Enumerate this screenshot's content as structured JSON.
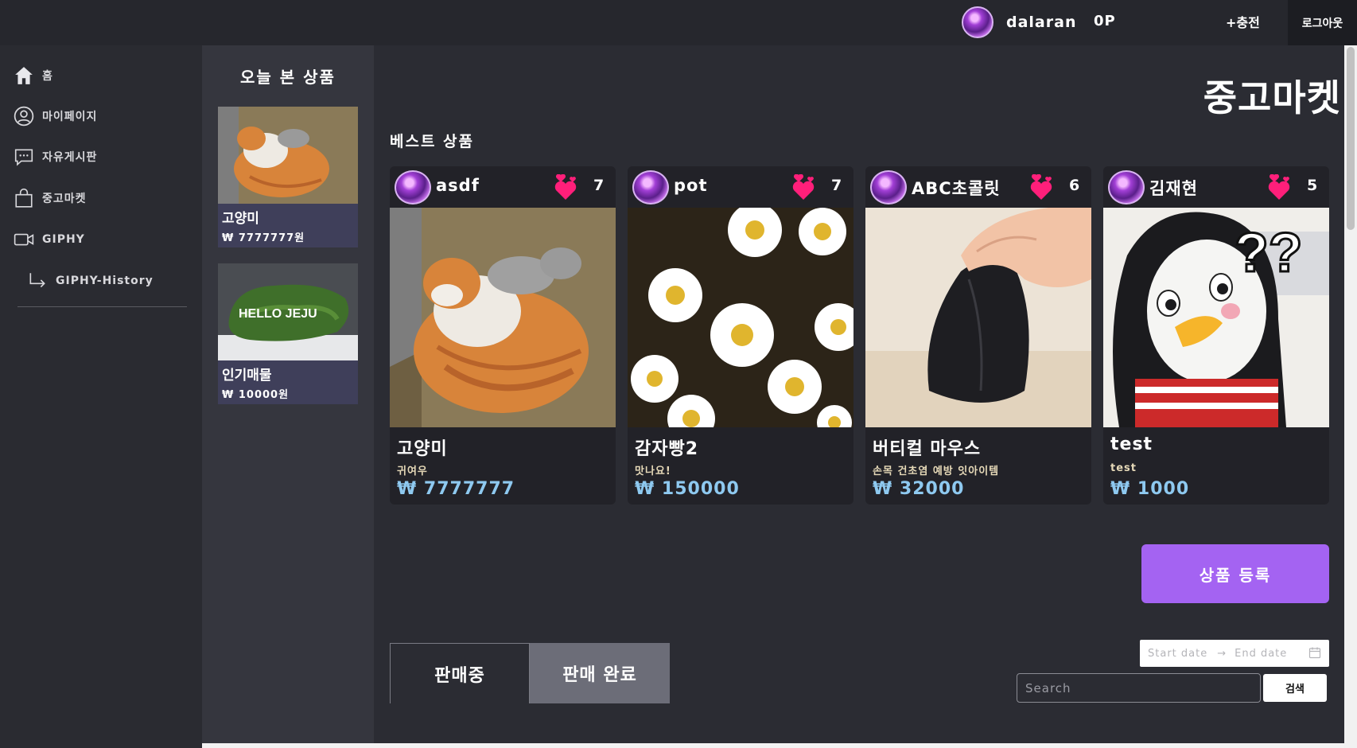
{
  "topbar": {
    "username": "dalaran",
    "points": "0P",
    "charge_label": "+충전",
    "logout_label": "로그아웃"
  },
  "sidebar": {
    "items": [
      {
        "label": "홈",
        "icon": "home-icon"
      },
      {
        "label": "마이페이지",
        "icon": "user-circle-icon"
      },
      {
        "label": "자유게시판",
        "icon": "chat-icon"
      },
      {
        "label": "중고마켓",
        "icon": "shopping-bag-icon"
      },
      {
        "label": "GIPHY",
        "icon": "video-camera-icon"
      },
      {
        "label": "GIPHY-History",
        "icon": "subdirectory-arrow-icon"
      }
    ]
  },
  "recent": {
    "title": "오늘 본 상품",
    "items": [
      {
        "title": "고양미",
        "price": "₩ 7777777원",
        "image": "cat-photo"
      },
      {
        "title": "인기매물",
        "price": "₩ 10000원",
        "image": "hello-jeju-sign"
      }
    ]
  },
  "main": {
    "page_title": "중고마켓",
    "best_title": "베스트 상품",
    "best": [
      {
        "seller": "asdf",
        "likes": "7",
        "name": "고양미",
        "desc": "귀여우",
        "price": "₩ 7777777",
        "image": "cat-photo"
      },
      {
        "seller": "pot",
        "likes": "7",
        "name": "감자빵2",
        "desc": "맛나요!",
        "price": "₩ 150000",
        "image": "daisies-photo"
      },
      {
        "seller": "ABC초콜릿",
        "likes": "6",
        "name": "버티컬 마우스",
        "desc": "손목 건초염 예방 잇아이템",
        "price": "₩ 32000",
        "image": "vertical-mouse-photo"
      },
      {
        "seller": "김재현",
        "likes": "5",
        "name": "test",
        "desc": "test",
        "price": "₩ 1000",
        "image": "penguin-photo"
      }
    ],
    "register_label": "상품 등록",
    "tabs": [
      "판매중",
      "판매 완료"
    ],
    "date_start_placeholder": "Start date",
    "date_end_placeholder": "End date",
    "search_placeholder": "Search",
    "search_button": "검색"
  },
  "colors": {
    "accent": "#a463f2",
    "price": "#8ec9f0",
    "heart": "#ff1f7a"
  }
}
